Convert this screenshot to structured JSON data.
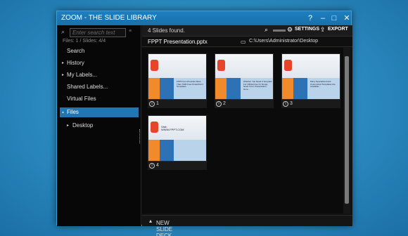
{
  "window": {
    "title": "ZOOM - THE SLIDE LIBRARY"
  },
  "window_controls": [
    "help-icon",
    "minimize-icon",
    "maximize-icon",
    "close-icon"
  ],
  "sidebar": {
    "search_placeholder": "Enter search text",
    "counts": "Files: 1 / Slides: 4/4",
    "items": [
      {
        "label": "Search",
        "arrow": ""
      },
      {
        "label": "History",
        "arrow": "▸"
      },
      {
        "label": "My Labels...",
        "arrow": "▸"
      },
      {
        "label": "Shared Labels...",
        "arrow": ""
      },
      {
        "label": "Virtual Files",
        "arrow": ""
      },
      {
        "label": "Files",
        "arrow": "▴"
      },
      {
        "label": "Desktop",
        "arrow": "▸"
      }
    ]
  },
  "toolbar": {
    "found": "4 Slides found.",
    "settings": "SETTINGS",
    "export": "EXPORT"
  },
  "path": {
    "file": "FPPT Presentation.pptx",
    "dir": "C:\\Users\\Administrator\\Desktop"
  },
  "slides": [
    {
      "num": "1",
      "text": "FPPT.Com Provides More Than 7000 Free PowerPoint Templates"
    },
    {
      "num": "2",
      "text": "Whether You Need A Template For Official Use Or Simply Need It For Presentation, Here..."
    },
    {
      "num": "3",
      "text": "Many Specialized and Customized Templates Are Available..."
    },
    {
      "num": "4",
      "text": "Visit: WWW.FPPT.COM"
    }
  ],
  "bottom": {
    "label": "NEW SLIDE DECK"
  }
}
